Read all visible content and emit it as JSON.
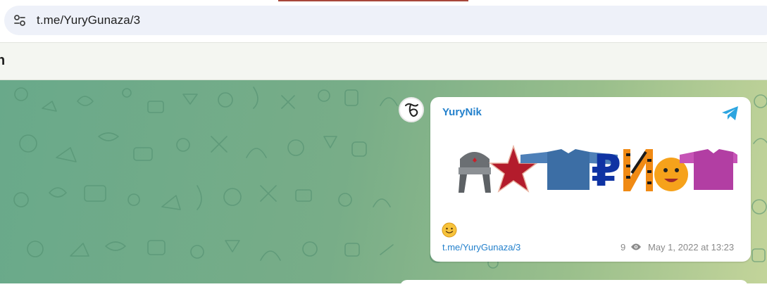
{
  "browser": {
    "url": "t.me/YuryGunaza/3",
    "tab_accent_color": "#a8473a"
  },
  "page_header": {
    "title_fragment": "n"
  },
  "post": {
    "author": "YuryNik",
    "avatar_icon": "stylized-letter-logo-icon",
    "sticker_items": [
      "ushanka-hat",
      "red-star",
      "blue-shirt",
      "ruble-sign",
      "ribbon-letter-i",
      "smiley-face",
      "pink-shirt"
    ],
    "emoji": "smiling-face-icon",
    "link": "t.me/YuryGunaza/3",
    "views": "9",
    "date": "May 1, 2022 at 13:23"
  },
  "colors": {
    "link_blue": "#2481cc",
    "chat_bg_start": "#69a98a",
    "chat_bg_end": "#c3d49a"
  }
}
